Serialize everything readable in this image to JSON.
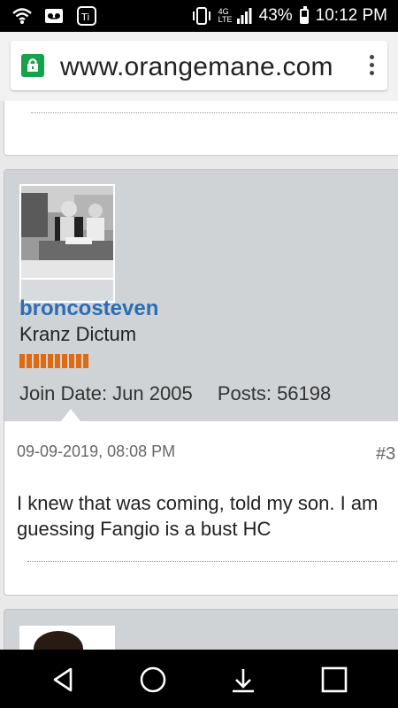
{
  "status_bar": {
    "network": "4G LTE",
    "battery_percent": "43%",
    "battery_level": 0.43,
    "time": "10:12 PM",
    "icons": [
      "wifi-icon",
      "voicemail-icon",
      "accessibility-icon",
      "vibrate-icon",
      "signal-icon",
      "battery-icon"
    ]
  },
  "browser": {
    "url": "www.orangemane.com",
    "security_icon": "lock-icon",
    "menu_icon": "more-vert-icon"
  },
  "post": {
    "username": "broncosteven",
    "user_title": "Kranz Dictum",
    "join_date": "Join Date: Jun 2005",
    "posts": "Posts: 56198",
    "date": "09-09-2019, 08:08 PM",
    "post_number": "#3",
    "body_line1": "I knew that was coming, told my son. I am",
    "body_line2": "guessing Fangio is a bust HC",
    "reputation_bars": 10,
    "colors": {
      "username": "#2b6db3",
      "reputation": "#e06a10",
      "userinfo_bg": "#cfd3d6"
    }
  },
  "nav": {
    "icons": [
      "back-icon",
      "home-icon",
      "download-icon",
      "recents-icon"
    ]
  }
}
